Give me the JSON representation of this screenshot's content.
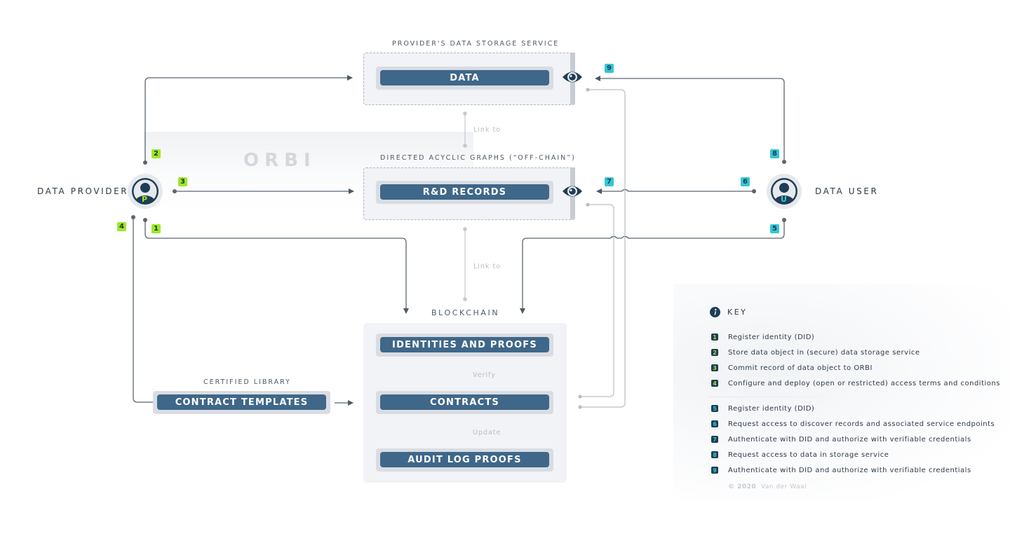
{
  "watermark": "ORBI",
  "actors": {
    "provider": {
      "label": "DATA PROVIDER",
      "initial": "P",
      "initial_color": "#9ee62d"
    },
    "user": {
      "label": "DATA USER",
      "initial": "U",
      "initial_color": "#35c6d2"
    }
  },
  "storage": {
    "caption": "PROVIDER'S DATA STORAGE SERVICE",
    "item": "DATA"
  },
  "dag": {
    "caption": "DIRECTED ACYCLIC GRAPHS (“OFF-CHAIN”)",
    "item": "R&D RECORDS"
  },
  "links": {
    "storage_to_dag": "Link to",
    "dag_to_chain": "Link to",
    "verify": "Verify",
    "update": "Update"
  },
  "blockchain": {
    "caption": "BLOCKCHAIN",
    "items": [
      "IDENTITIES AND PROOFS",
      "CONTRACTS",
      "AUDIT LOG PROOFS"
    ]
  },
  "library": {
    "caption": "CERTIFIED LIBRARY",
    "item": "CONTRACT TEMPLATES"
  },
  "badges": {
    "b1": "1",
    "b2": "2",
    "b3": "3",
    "b4": "4",
    "b5": "5",
    "b6": "6",
    "b7": "7",
    "b8": "8",
    "b9": "9"
  },
  "colors": {
    "provider_accent": "#9ee62d",
    "user_accent": "#35c6d2",
    "pill": "#3f6789",
    "navy": "#1f3d54"
  },
  "key": {
    "title": "KEY",
    "provider_steps": [
      {
        "num": "1",
        "text": "Register identity (DID)"
      },
      {
        "num": "2",
        "text": "Store data object in (secure) data storage service"
      },
      {
        "num": "3",
        "text": "Commit record of data object to ORBI"
      },
      {
        "num": "4",
        "text": "Configure and deploy (open or restricted) access terms and conditions"
      }
    ],
    "user_steps": [
      {
        "num": "5",
        "text": "Register identity (DID)"
      },
      {
        "num": "6",
        "text": "Request access to discover records and associated service endpoints"
      },
      {
        "num": "7",
        "text": "Authenticate with DID and authorize with verifiable credentials"
      },
      {
        "num": "8",
        "text": "Request access to data in storage service"
      },
      {
        "num": "9",
        "text": "Authenticate with DID and authorize with verifiable credentials"
      }
    ],
    "copyright_year": "© 2020",
    "copyright_name": "Van der Waal"
  }
}
